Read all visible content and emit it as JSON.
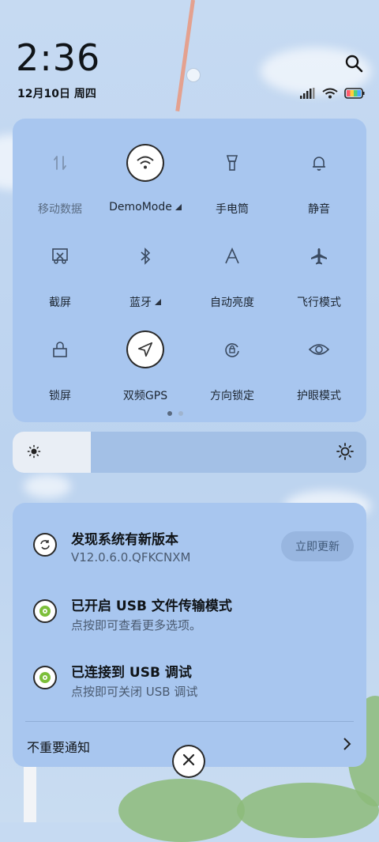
{
  "status": {
    "time": "2:36",
    "date": "12月10日 周四"
  },
  "quick_settings": {
    "tiles": [
      {
        "label": "移动数据",
        "icon": "mobile-data-icon",
        "active": false,
        "dim": true
      },
      {
        "label": "DemoMode",
        "icon": "wifi-icon",
        "active": true,
        "dim": false,
        "expandable": true
      },
      {
        "label": "手电筒",
        "icon": "flashlight-icon",
        "active": false,
        "dim": false
      },
      {
        "label": "静音",
        "icon": "bell-icon",
        "active": false,
        "dim": false
      },
      {
        "label": "截屏",
        "icon": "screenshot-icon",
        "active": false,
        "dim": false
      },
      {
        "label": "蓝牙",
        "icon": "bluetooth-icon",
        "active": false,
        "dim": false,
        "expandable": true
      },
      {
        "label": "自动亮度",
        "icon": "auto-brightness-icon",
        "active": false,
        "dim": false
      },
      {
        "label": "飞行模式",
        "icon": "airplane-icon",
        "active": false,
        "dim": false
      },
      {
        "label": "锁屏",
        "icon": "lock-icon",
        "active": false,
        "dim": false
      },
      {
        "label": "双频GPS",
        "icon": "gps-icon",
        "active": true,
        "dim": false
      },
      {
        "label": "方向锁定",
        "icon": "rotation-lock-icon",
        "active": false,
        "dim": false
      },
      {
        "label": "护眼模式",
        "icon": "eye-icon",
        "active": false,
        "dim": false
      }
    ],
    "page_count": 2,
    "current_page": 1
  },
  "brightness": {
    "level": 0.22
  },
  "notifications": [
    {
      "title": "发现系统有新版本",
      "subtitle": "V12.0.6.0.QFKCNXM",
      "icon": "update-icon",
      "action": "立即更新"
    },
    {
      "title": "已开启 USB 文件传输模式",
      "subtitle": "点按即可查看更多选项。",
      "icon": "android-settings-icon"
    },
    {
      "title": "已连接到 USB 调试",
      "subtitle": "点按即可关闭 USB 调试",
      "icon": "android-settings-icon"
    }
  ],
  "minor_notifications": {
    "label": "不重要通知"
  },
  "colors": {
    "panel": "#a8c6ef",
    "accent_green": "#7cbf3a"
  }
}
